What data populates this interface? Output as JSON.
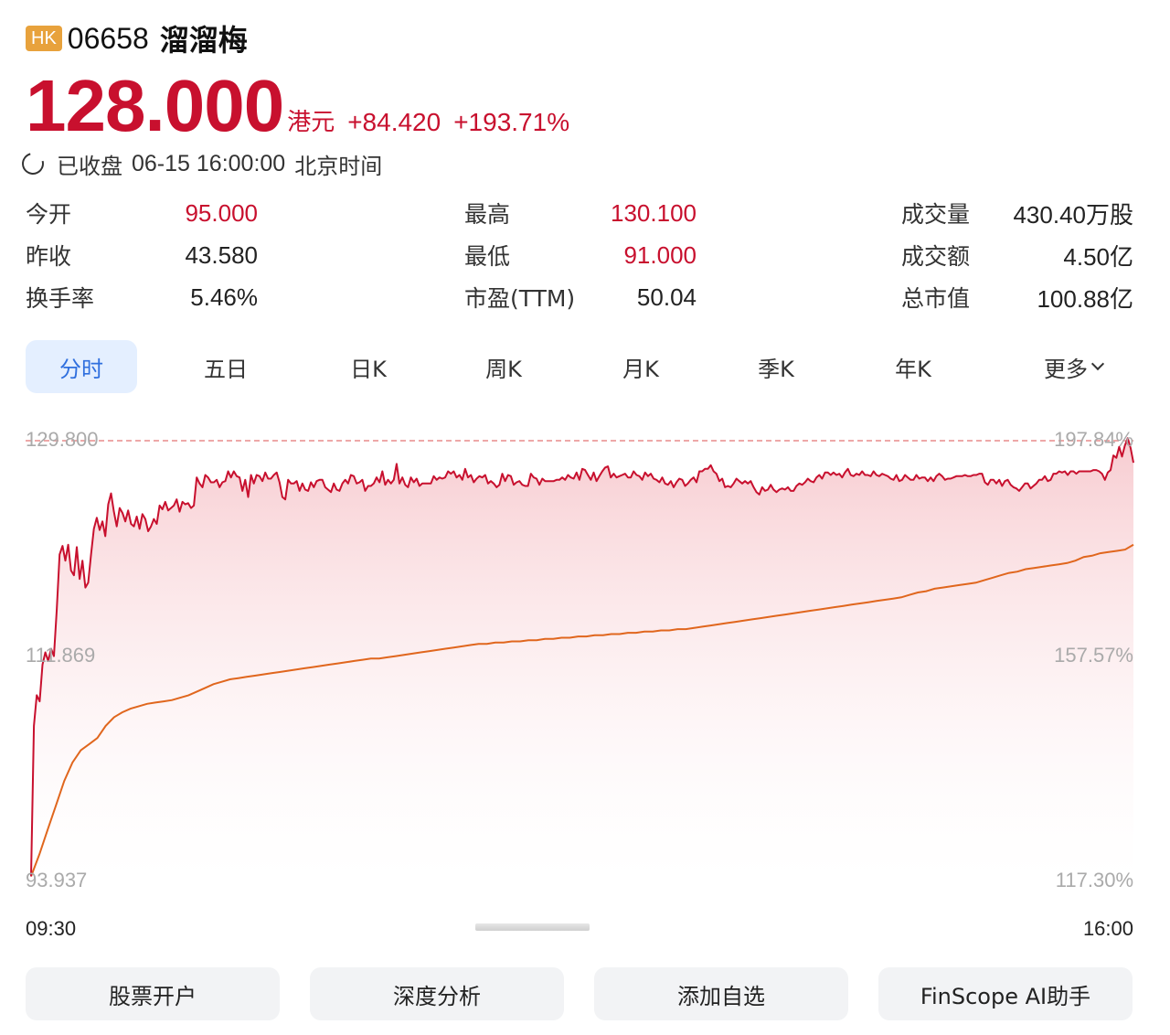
{
  "header": {
    "market_badge": "HK",
    "code": "06658",
    "name": "溜溜梅"
  },
  "quote": {
    "price": "128.000",
    "currency": "港元",
    "change": "+84.420",
    "change_pct": "+193.71%"
  },
  "status": {
    "label": "已收盘",
    "datetime": "06-15 16:00:00",
    "timezone": "北京时间"
  },
  "stats": {
    "col1": [
      {
        "label": "今开",
        "value": "95.000",
        "tone": "red"
      },
      {
        "label": "昨收",
        "value": "43.580",
        "tone": "dark"
      },
      {
        "label": "换手率",
        "value": "5.46%",
        "tone": "dark"
      }
    ],
    "col2": [
      {
        "label": "最高",
        "value": "130.100",
        "tone": "red"
      },
      {
        "label": "最低",
        "value": "91.000",
        "tone": "red"
      },
      {
        "label": "市盈(TTM)",
        "value": "50.04",
        "tone": "dark"
      }
    ],
    "col3": [
      {
        "label": "成交量",
        "value": "430.40万股",
        "tone": "dark"
      },
      {
        "label": "成交额",
        "value": "4.50亿",
        "tone": "dark"
      },
      {
        "label": "总市值",
        "value": "100.88亿",
        "tone": "dark"
      }
    ]
  },
  "tabs": [
    {
      "label": "分时",
      "active": true
    },
    {
      "label": "五日"
    },
    {
      "label": "日K"
    },
    {
      "label": "周K"
    },
    {
      "label": "月K"
    },
    {
      "label": "季K"
    },
    {
      "label": "年K"
    },
    {
      "label": "更多"
    }
  ],
  "colors": {
    "price_line": "#c8102e",
    "avg_line": "#e0661d",
    "fill": "#f5c6cb",
    "ref_line": "#e88b8b",
    "tab_active_bg": "#e4efff",
    "tab_active_text": "#2f6fde"
  },
  "chart_data": {
    "type": "line",
    "y_left_ticks": [
      "129.800",
      "111.869",
      "93.937"
    ],
    "y_right_ticks": [
      "197.84%",
      "157.57%",
      "117.30%"
    ],
    "x_ticks": [
      "09:30",
      "16:00"
    ],
    "ylim": [
      93.937,
      129.8
    ],
    "reference_line": 129.8,
    "series": [
      {
        "values": [
          94.2,
          106.5,
          109.0,
          108.5,
          111.5,
          112.5,
          111.8,
          112.8,
          112.2,
          116.0,
          120.5,
          121.2,
          120.0,
          121.3,
          119.2,
          118.8,
          121.1,
          118.5,
          120.0,
          117.8,
          118.2,
          120.5,
          122.6,
          123.5,
          122.5,
          123.2,
          122.0,
          124.6,
          125.5,
          124.0,
          122.8,
          124.3,
          123.9,
          123.2,
          124.1,
          123.0,
          122.8,
          123.6,
          122.6,
          123.8,
          123.4,
          122.4,
          122.8,
          123.4,
          123.0,
          124.5,
          124.2,
          124.8,
          124.1,
          124.3,
          124.5,
          125.0,
          124.0,
          124.8,
          124.6,
          124.7,
          124.3,
          124.5,
          126.8,
          126.3,
          126.0,
          127.0,
          126.8,
          126.4,
          126.4,
          126.6,
          126.0,
          126.4,
          126.5,
          127.3,
          126.8,
          127.3,
          126.9,
          126.8,
          125.7,
          126.6,
          125.2,
          127.0,
          126.3,
          127.0,
          126.9,
          126.5,
          127.2,
          126.7,
          126.7,
          127.0,
          127.2,
          126.4,
          125.2,
          125.0,
          126.6,
          126.3,
          126.3,
          126.5,
          125.7,
          126.3,
          125.8,
          125.7,
          126.4,
          126.0,
          126.5,
          126.6,
          126.6,
          126.0,
          125.8,
          125.6,
          126.3,
          125.8,
          125.7,
          126.3,
          126.6,
          126.3,
          127.0,
          126.9,
          126.3,
          126.4,
          126.6,
          125.7,
          126.1,
          126.1,
          126.3,
          126.8,
          126.4,
          127.3,
          126.2,
          126.6,
          126.3,
          126.6,
          127.9,
          126.3,
          126.8,
          126.2,
          126.0,
          126.8,
          126.4,
          126.7,
          126.1,
          126.3,
          126.3,
          126.3,
          126.3,
          126.9,
          126.6,
          126.8,
          126.7,
          126.8,
          127.3,
          127.1,
          127.3,
          126.8,
          127.0,
          126.6,
          127.5,
          126.8,
          127.0,
          126.4,
          126.7,
          126.9,
          126.8,
          127.0,
          126.3,
          126.5,
          126.3,
          126.0,
          126.2,
          127.1,
          126.5,
          127.0,
          126.9,
          126.2,
          126.4,
          126.5,
          126.2,
          126.1,
          126.1,
          127.1,
          126.8,
          126.7,
          126.2,
          126.7,
          126.5,
          126.5,
          126.5,
          126.5,
          126.6,
          126.6,
          126.8,
          126.6,
          127.0,
          126.8,
          126.7,
          127.2,
          126.6,
          127.5,
          127.4,
          127.0,
          126.6,
          127.2,
          126.5,
          126.9,
          127.3,
          127.6,
          127.7,
          126.8,
          127.1,
          126.8,
          126.9,
          127.0,
          127.1,
          126.8,
          126.8,
          127.3,
          127.0,
          126.9,
          126.6,
          127.2,
          126.9,
          127.1,
          126.7,
          126.6,
          126.4,
          126.8,
          126.3,
          126.2,
          126.5,
          126.0,
          126.4,
          126.7,
          126.6,
          126.1,
          126.3,
          126.6,
          126.8,
          126.4,
          127.3,
          127.3,
          127.5,
          127.5,
          127.8,
          127.3,
          127.1,
          126.5,
          126.7,
          126.0,
          126.1,
          126.0,
          126.3,
          126.7,
          126.5,
          126.3,
          126.5,
          126.3,
          126.5,
          126.0,
          125.6,
          125.4,
          126.0,
          125.7,
          125.8,
          126.2,
          125.8,
          125.6,
          125.8,
          125.9,
          125.8,
          126.0,
          125.7,
          125.7,
          126.1,
          126.3,
          126.2,
          126.4,
          126.7,
          126.5,
          126.4,
          126.8,
          127.0,
          126.7,
          127.2,
          127.2,
          127.0,
          127.2,
          127.0,
          127.1,
          126.8,
          127.2,
          127.5,
          127.0,
          126.9,
          127.1,
          127.0,
          127.3,
          127.0,
          127.0,
          126.9,
          127.3,
          127.0,
          126.9,
          127.1,
          127.0,
          126.9,
          126.7,
          126.6,
          127.0,
          126.5,
          126.6,
          127.0,
          126.8,
          126.6,
          126.6,
          127.0,
          126.7,
          126.8,
          126.8,
          126.5,
          126.8,
          126.5,
          126.9,
          127.1,
          126.9,
          126.6,
          126.7,
          126.7,
          126.8,
          126.9,
          126.9,
          126.9,
          127.0,
          126.9,
          126.9,
          127.0,
          127.0,
          127.1,
          127.1,
          126.4,
          126.2,
          126.6,
          126.6,
          126.3,
          126.6,
          126.1,
          126.5,
          126.6,
          126.2,
          126.0,
          125.9,
          125.7,
          126.0,
          126.3,
          126.3,
          125.9,
          126.1,
          126.3,
          126.6,
          126.6,
          126.9,
          126.5,
          126.6,
          127.1,
          127.1,
          127.3,
          127.2,
          127.3,
          127.0,
          127.3,
          127.3,
          127.1,
          127.3,
          127.3,
          127.3,
          127.3,
          127.3,
          127.4,
          127.4,
          127.3,
          127.1,
          126.6,
          127.2,
          127.4,
          128.6,
          128.4,
          129.3,
          128.5,
          129.4,
          130.0,
          129.2,
          128.0
        ]
      },
      {
        "values": [
          94.2,
          96.0,
          98.0,
          100.0,
          102.0,
          103.5,
          104.5,
          105.0,
          105.5,
          106.5,
          107.2,
          107.6,
          107.9,
          108.1,
          108.3,
          108.4,
          108.5,
          108.6,
          108.8,
          109.0,
          109.3,
          109.6,
          109.9,
          110.1,
          110.3,
          110.4,
          110.5,
          110.6,
          110.7,
          110.8,
          110.9,
          111.0,
          111.1,
          111.2,
          111.3,
          111.4,
          111.5,
          111.6,
          111.7,
          111.8,
          111.9,
          112.0,
          112.0,
          112.1,
          112.2,
          112.3,
          112.4,
          112.5,
          112.6,
          112.7,
          112.8,
          112.9,
          113.0,
          113.1,
          113.2,
          113.2,
          113.3,
          113.3,
          113.4,
          113.4,
          113.5,
          113.5,
          113.6,
          113.6,
          113.7,
          113.7,
          113.8,
          113.8,
          113.9,
          113.9,
          114.0,
          114.0,
          114.1,
          114.1,
          114.2,
          114.2,
          114.3,
          114.3,
          114.4,
          114.4,
          114.5,
          114.6,
          114.7,
          114.8,
          114.9,
          115.0,
          115.1,
          115.2,
          115.3,
          115.4,
          115.5,
          115.6,
          115.7,
          115.8,
          115.9,
          116.0,
          116.1,
          116.2,
          116.3,
          116.4,
          116.5,
          116.6,
          116.7,
          116.8,
          116.9,
          117.0,
          117.2,
          117.4,
          117.5,
          117.7,
          117.8,
          117.9,
          118.0,
          118.1,
          118.2,
          118.4,
          118.6,
          118.8,
          119.0,
          119.1,
          119.3,
          119.4,
          119.5,
          119.6,
          119.7,
          119.8,
          120.0,
          120.3,
          120.4,
          120.6,
          120.7,
          120.8,
          120.9,
          121.3
        ]
      }
    ]
  },
  "actions": [
    {
      "label": "股票开户"
    },
    {
      "label": "深度分析"
    },
    {
      "label": "添加自选"
    },
    {
      "label": "FinScope AI助手"
    }
  ]
}
